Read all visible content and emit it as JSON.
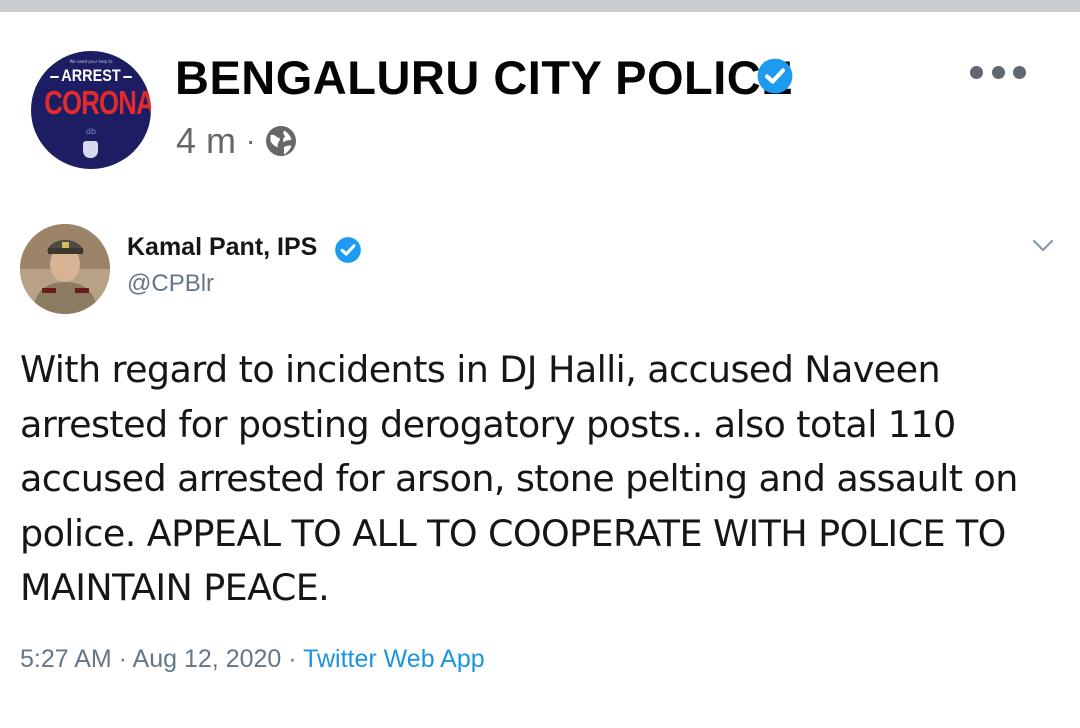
{
  "page": {
    "name": "BENGALURU CITY POLICE",
    "time": "4 m",
    "separator": "·",
    "avatar": {
      "top_small": "We need your help to",
      "line1": "ARREST",
      "line2": "CORONA",
      "bottom": "db"
    },
    "icons": [
      "verified-badge-icon",
      "globe-icon",
      "more-options-icon"
    ]
  },
  "tweet": {
    "name": "Kamal Pant, IPS",
    "handle": "@CPBlr",
    "text": "With regard to incidents in DJ Halli, accused Naveen arrested for posting derogatory posts.. also total 110 accused arrested for arson, stone pelting and assault on police. APPEAL TO ALL TO COOPERATE WITH POLICE TO MAINTAIN PEACE.",
    "timestamp": "5:27 AM · Aug 12, 2020 · ",
    "source": "Twitter Web App"
  },
  "colors": {
    "verified": "#1d9bf0",
    "link": "#1b95e0",
    "avatar_bg": "#1c1d63",
    "corona_red": "#e32b2e"
  }
}
